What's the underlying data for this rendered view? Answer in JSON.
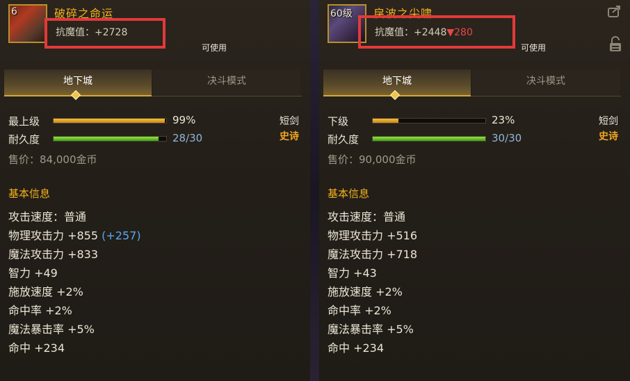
{
  "left": {
    "level": "6",
    "name": "破碎之命运",
    "resist_label": "抗魔值：",
    "resist_value": "+2728",
    "restrict_text": "可使用",
    "tabs": [
      "地下城",
      "决斗模式"
    ],
    "grade_label": "最上级",
    "grade_pct": "99%",
    "grade_fraction": 0.99,
    "durability_label": "耐久度",
    "durability": "28/30",
    "durability_fraction": 0.93,
    "weapon_type": "短剑",
    "rarity": "史诗",
    "price": "售价：84,000金币",
    "section_title": "基本信息",
    "attrs": {
      "attack_speed": "攻击速度：普通",
      "phys_attack": "物理攻击力 +855",
      "phys_bonus": "(+257)",
      "magic_attack": "魔法攻击力 +833",
      "intelligence": "智力 +49",
      "cast_speed": "施放速度 +2%",
      "hit_rate": "命中率 +2%",
      "magic_crit": "魔法暴击率 +5%",
      "hit": "命中 +234"
    }
  },
  "right": {
    "level": "60级",
    "name": "戾波之尖啸",
    "resist_label": "抗魔值：",
    "resist_value": "+2448",
    "resist_diff": "▼280",
    "restrict_text": "可使用",
    "tabs": [
      "地下城",
      "决斗模式"
    ],
    "grade_label": "下级",
    "grade_pct": "23%",
    "grade_fraction": 0.23,
    "durability_label": "耐久度",
    "durability": "30/30",
    "durability_fraction": 1.0,
    "weapon_type": "短剑",
    "rarity": "史诗",
    "price": "售价：90,000金币",
    "section_title": "基本信息",
    "attrs": {
      "attack_speed": "攻击速度：普通",
      "phys_attack": "物理攻击力 +516",
      "magic_attack": "魔法攻击力 +718",
      "intelligence": "智力 +43",
      "cast_speed": "施放速度 +2%",
      "hit_rate": "命中率 +2%",
      "magic_crit": "魔法暴击率 +5%",
      "hit": "命中 +234"
    }
  },
  "colors": {
    "item_name": "#f2b21c",
    "highlight_box": "#e23a3a",
    "epic": "#f2a624",
    "bonus_blue": "#5aa8f0",
    "durability_text": "#8fb6d8"
  },
  "icons": [
    "export-icon",
    "lock-icon",
    "weapon-icon",
    "tab-indicator-diamond"
  ]
}
